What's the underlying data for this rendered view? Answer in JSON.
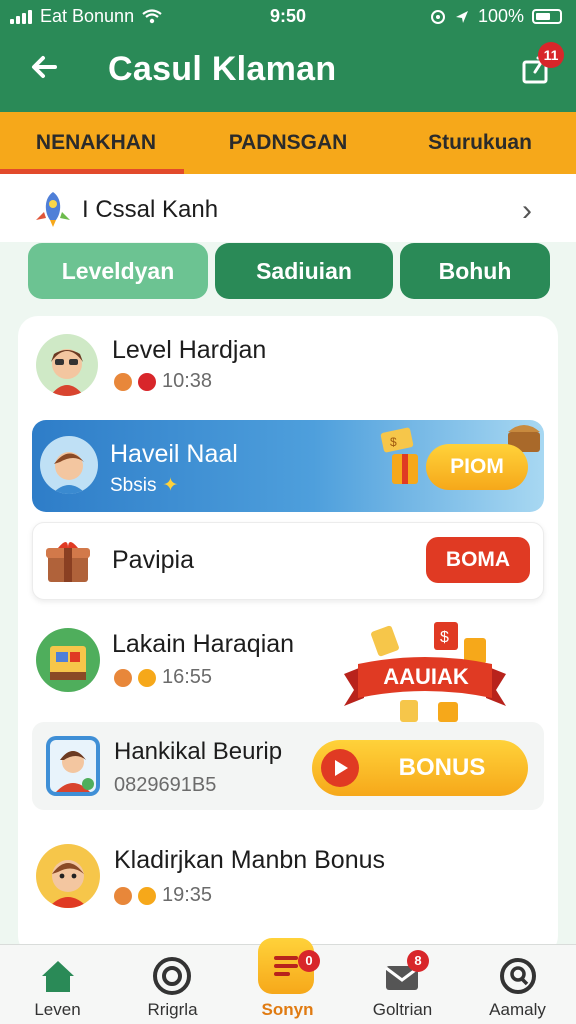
{
  "status_bar": {
    "carrier": "Eat Bonunn",
    "time": "9:50",
    "battery": "100%"
  },
  "app_bar": {
    "title": "Casul Klaman",
    "notification_count": "11"
  },
  "tabs": [
    {
      "label": "NENAKHAN",
      "active": true
    },
    {
      "label": "PADNSGAN",
      "active": false
    },
    {
      "label": "Sturukuan",
      "active": false
    }
  ],
  "section": {
    "label": "I Cssal Kanh"
  },
  "filters": [
    {
      "label": "Leveldyan"
    },
    {
      "label": "Sadiuian"
    },
    {
      "label": "Bohuh"
    }
  ],
  "items": {
    "row1": {
      "title": "Level Hardjan",
      "meta": "10:38"
    },
    "row2": {
      "title": "Haveil Naal",
      "subtitle": "Sbsis",
      "button": "PIOM"
    },
    "row3": {
      "title": "Pavipia",
      "button": "BOMA"
    },
    "row4": {
      "title": "Lakain Haraqian",
      "meta": "16:55",
      "ribbon": "AAUIAK"
    },
    "row5": {
      "title": "Hankikal Beurip",
      "meta": "0829691B5",
      "button": "BONUS"
    },
    "row6": {
      "title": "Kladirjkan Manbn Bonus",
      "meta": "19:35"
    }
  },
  "bottom_nav": [
    {
      "label": "Leven"
    },
    {
      "label": "Rrigrla"
    },
    {
      "label": "Sonyn",
      "badge": "0"
    },
    {
      "label": "Goltrian",
      "badge": "8"
    },
    {
      "label": "Aamaly"
    }
  ],
  "colors": {
    "primary_green": "#2a8a57",
    "accent_orange": "#f6a81a",
    "alert_red": "#e03a23"
  }
}
